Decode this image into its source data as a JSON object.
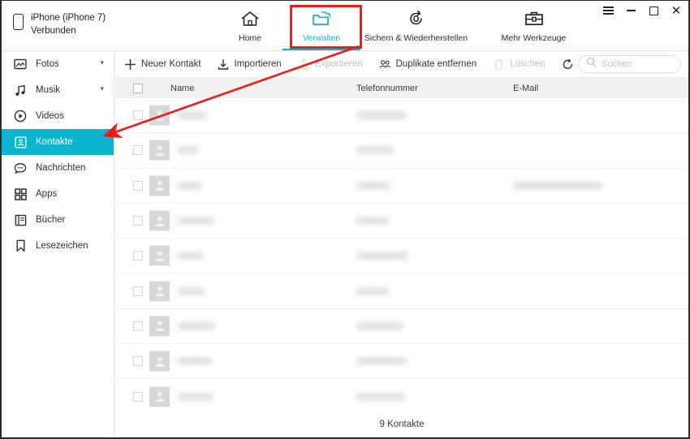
{
  "window": {
    "controls": [
      {
        "name": "menu",
        "label": "☰"
      },
      {
        "name": "minimize",
        "label": "–"
      },
      {
        "name": "maximize",
        "label": "□"
      },
      {
        "name": "close",
        "label": "✕"
      }
    ]
  },
  "device": {
    "icon": "phone-icon",
    "name": "iPhone (iPhone 7)",
    "status": "Verbunden"
  },
  "nav": {
    "active": "Verwalten",
    "tabs": [
      {
        "id": "home",
        "label": "Home",
        "icon": "home-icon",
        "active": false
      },
      {
        "id": "verwalten",
        "label": "Verwalten",
        "icon": "folder-icon",
        "active": true
      },
      {
        "id": "sichern",
        "label": "Sichern & Wiederherstellen",
        "icon": "restore-icon",
        "active": false
      },
      {
        "id": "werkzeuge",
        "label": "Mehr Werkzeuge",
        "icon": "toolbox-icon",
        "active": false
      }
    ]
  },
  "sidebar": {
    "items": [
      {
        "id": "fotos",
        "label": "Fotos",
        "icon": "photo-icon",
        "expandable": true,
        "active": false
      },
      {
        "id": "musik",
        "label": "Musik",
        "icon": "music-icon",
        "expandable": true,
        "active": false
      },
      {
        "id": "videos",
        "label": "Videos",
        "icon": "video-icon",
        "expandable": false,
        "active": false
      },
      {
        "id": "kontakte",
        "label": "Kontakte",
        "icon": "contact-icon",
        "expandable": false,
        "active": true
      },
      {
        "id": "nachrichten",
        "label": "Nachrichten",
        "icon": "message-icon",
        "expandable": false,
        "active": false
      },
      {
        "id": "apps",
        "label": "Apps",
        "icon": "apps-icon",
        "expandable": false,
        "active": false
      },
      {
        "id": "buecher",
        "label": "Bücher",
        "icon": "book-icon",
        "expandable": false,
        "active": false
      },
      {
        "id": "lesezeichen",
        "label": "Lesezeichen",
        "icon": "bookmark-icon",
        "expandable": false,
        "active": false
      }
    ]
  },
  "toolbar": {
    "buttons": [
      {
        "id": "neuer-kontakt",
        "label": "Neuer Kontakt",
        "icon": "plus-icon",
        "disabled": false
      },
      {
        "id": "importieren",
        "label": "Importieren",
        "icon": "import-icon",
        "disabled": false
      },
      {
        "id": "exportieren",
        "label": "Exportieren",
        "icon": "export-icon",
        "disabled": true
      },
      {
        "id": "duplikate-entfernen",
        "label": "Duplikate entfernen",
        "icon": "duplicate-users-icon",
        "disabled": false
      },
      {
        "id": "loeschen",
        "label": "Löschen",
        "icon": "trash-icon",
        "disabled": true
      },
      {
        "id": "aktualisieren",
        "label": "Aktualisieren",
        "icon": "refresh-icon",
        "disabled": false
      }
    ],
    "search": {
      "placeholder": "Suchen",
      "value": "",
      "icon": "search-icon"
    }
  },
  "table": {
    "select_all_checked": false,
    "columns": [
      {
        "id": "name",
        "label": "Name"
      },
      {
        "id": "phone",
        "label": "Telefonnummer"
      },
      {
        "id": "email",
        "label": "E-Mail"
      }
    ],
    "rows": [
      {
        "checked": false,
        "avatar": "person-icon",
        "name_w": 36,
        "phone_w": 62,
        "email_w": 0
      },
      {
        "checked": false,
        "avatar": "person-icon",
        "name_w": 25,
        "phone_w": 46,
        "email_w": 0
      },
      {
        "checked": false,
        "avatar": "person-icon",
        "name_w": 30,
        "phone_w": 42,
        "email_w": 110
      },
      {
        "checked": false,
        "avatar": "person-icon",
        "name_w": 45,
        "phone_w": 40,
        "email_w": 0
      },
      {
        "checked": false,
        "avatar": "person-icon",
        "name_w": 31,
        "phone_w": 64,
        "email_w": 0
      },
      {
        "checked": false,
        "avatar": "person-icon",
        "name_w": 33,
        "phone_w": 40,
        "email_w": 0
      },
      {
        "checked": false,
        "avatar": "person-icon",
        "name_w": 46,
        "phone_w": 58,
        "email_w": 0
      },
      {
        "checked": false,
        "avatar": "person-icon",
        "name_w": 42,
        "phone_w": 62,
        "email_w": 0
      },
      {
        "checked": false,
        "avatar": "person-icon",
        "name_w": 44,
        "phone_w": 60,
        "email_w": 0
      }
    ]
  },
  "footer": {
    "count_text": "9 Kontakte"
  },
  "annotations": {
    "highlight_box": {
      "target": "Verwalten",
      "color": "#ee1b17"
    },
    "arrow": {
      "from": "Verwalten",
      "to": "Kontakte",
      "color": "#ee1b17"
    }
  },
  "colors": {
    "accent": "#0cb4cd",
    "annotation": "#ee1b17",
    "header_bg": "#f0f0f0",
    "text": "#2d2d2d"
  }
}
